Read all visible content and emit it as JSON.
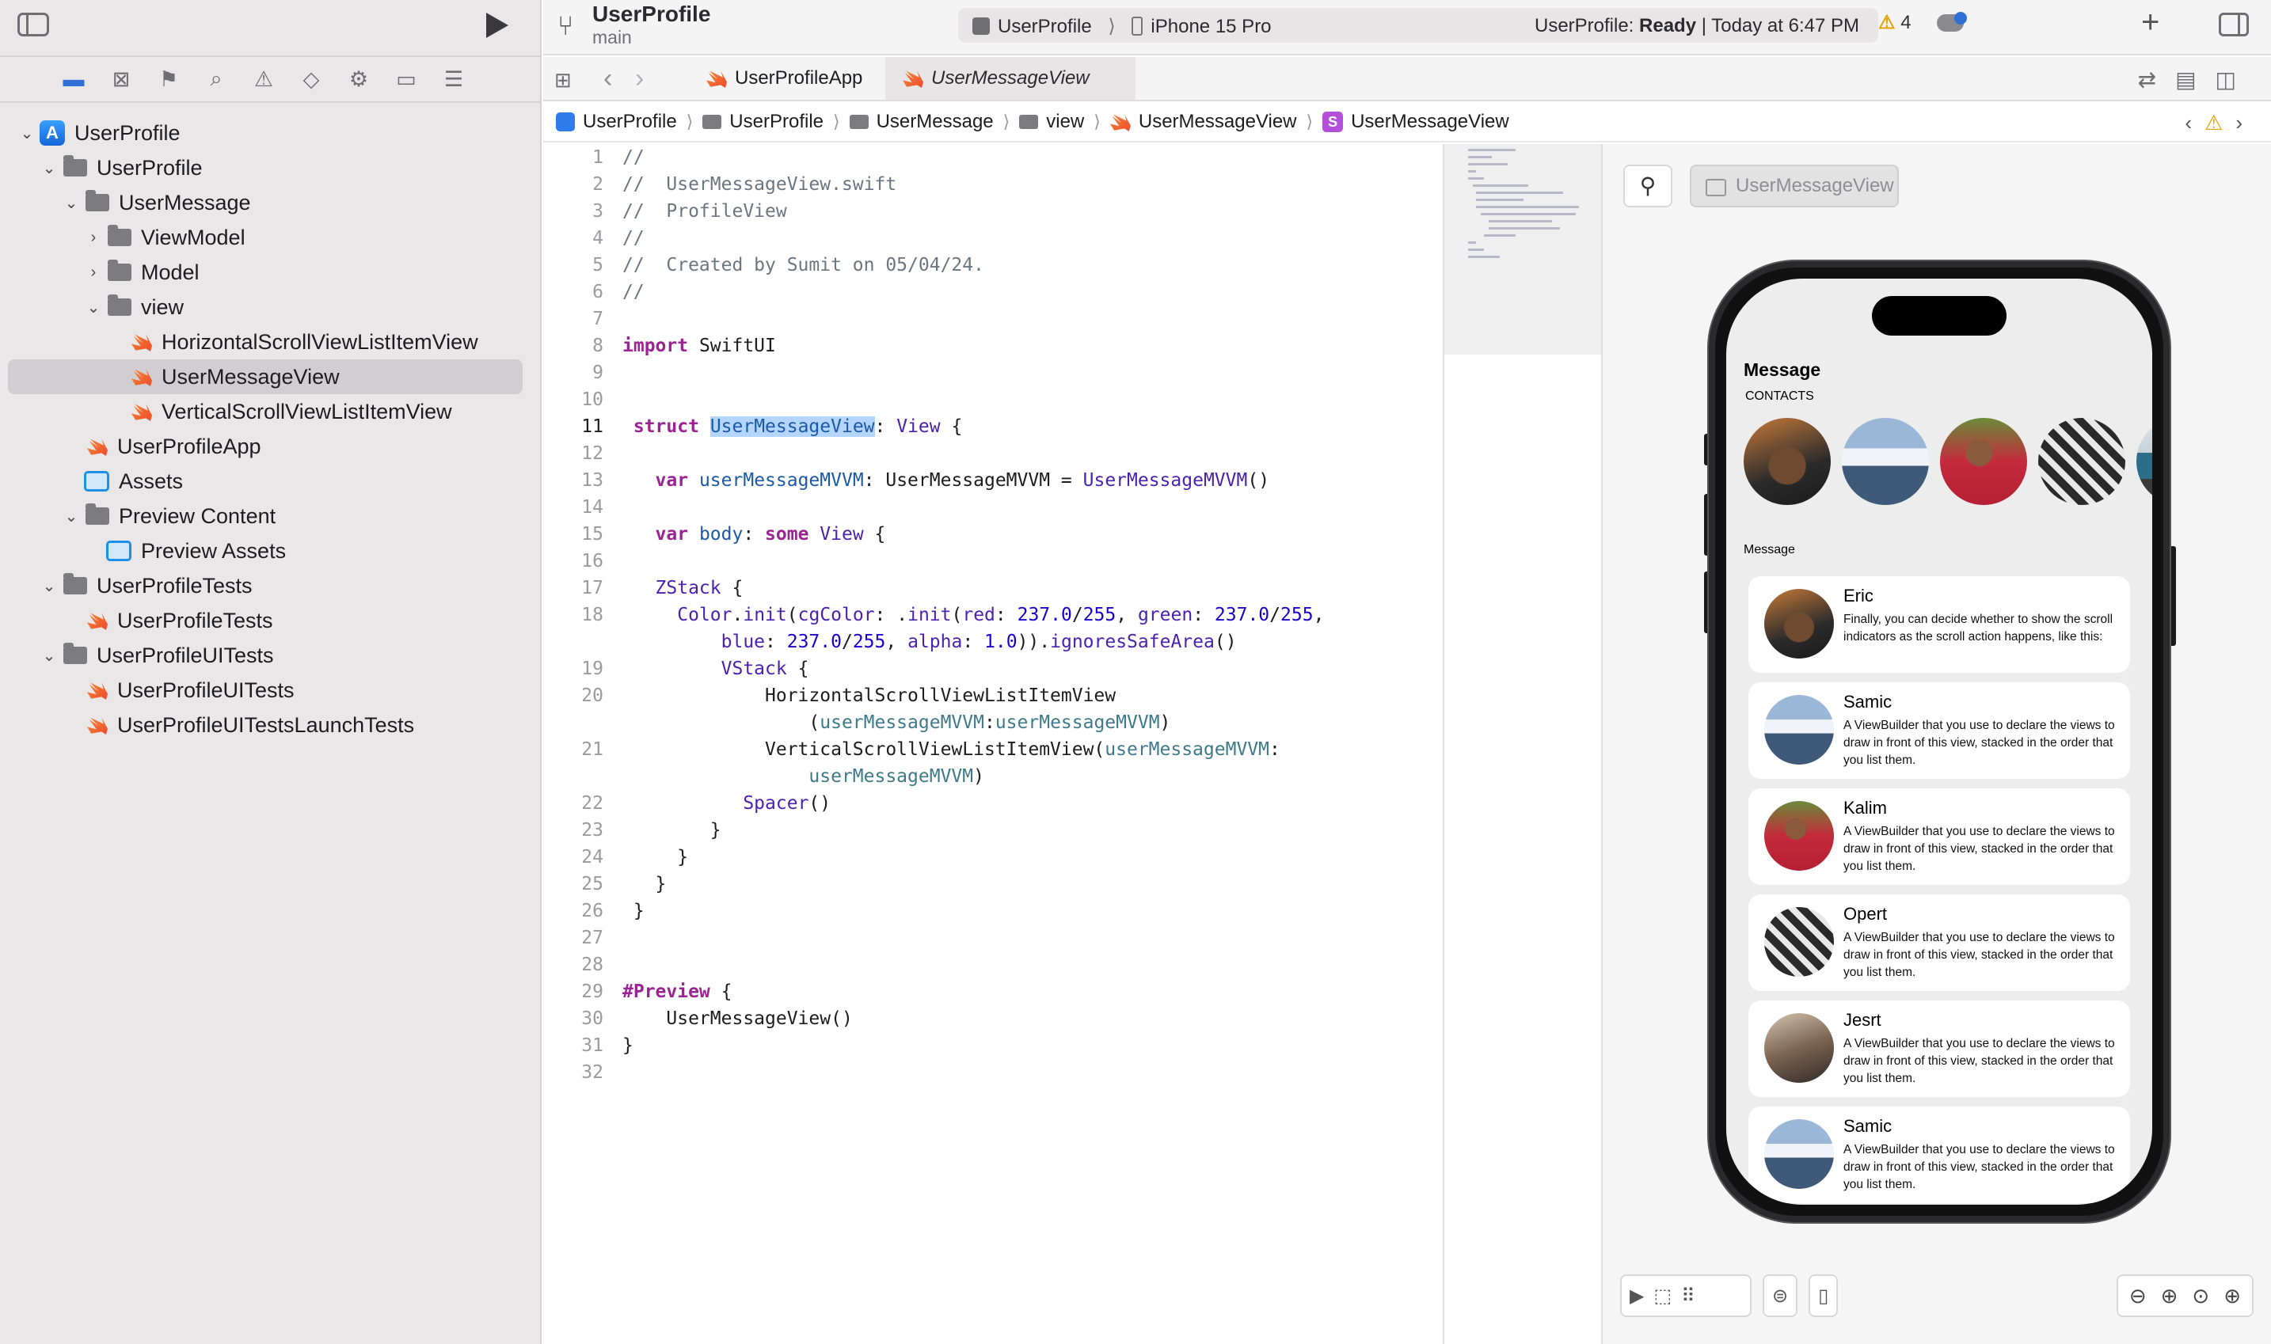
{
  "topbar": {
    "project": "UserProfile",
    "branch": "main",
    "scheme": "UserProfile",
    "destination": "iPhone 15 Pro",
    "status_prefix": "UserProfile: ",
    "status_state": "Ready",
    "status_suffix": " | Today at 6:47 PM",
    "warnings": "4"
  },
  "tabs": [
    {
      "label": "UserProfileApp"
    },
    {
      "label": "UserMessageView"
    }
  ],
  "jumpbar": [
    "UserProfile",
    "UserProfile",
    "UserMessage",
    "view",
    "UserMessageView",
    "UserMessageView"
  ],
  "tree": [
    {
      "label": "UserProfile",
      "indent": 0,
      "chev": "⌄",
      "icon": "proj"
    },
    {
      "label": "UserProfile",
      "indent": 1,
      "chev": "⌄",
      "icon": "folder"
    },
    {
      "label": "UserMessage",
      "indent": 2,
      "chev": "⌄",
      "icon": "folder"
    },
    {
      "label": "ViewModel",
      "indent": 3,
      "chev": "›",
      "icon": "folder"
    },
    {
      "label": "Model",
      "indent": 3,
      "chev": "›",
      "icon": "folder"
    },
    {
      "label": "view",
      "indent": 3,
      "chev": "⌄",
      "icon": "folder"
    },
    {
      "label": "HorizontalScrollViewListItemView",
      "indent": 4,
      "chev": "",
      "icon": "swift"
    },
    {
      "label": "UserMessageView",
      "indent": 4,
      "chev": "",
      "icon": "swift",
      "selected": true
    },
    {
      "label": "VerticalScrollViewListItemView",
      "indent": 4,
      "chev": "",
      "icon": "swift"
    },
    {
      "label": "UserProfileApp",
      "indent": 2,
      "chev": "",
      "icon": "swift"
    },
    {
      "label": "Assets",
      "indent": 2,
      "chev": "",
      "icon": "assets"
    },
    {
      "label": "Preview Content",
      "indent": 2,
      "chev": "⌄",
      "icon": "folder"
    },
    {
      "label": "Preview Assets",
      "indent": 3,
      "chev": "",
      "icon": "assets"
    },
    {
      "label": "UserProfileTests",
      "indent": 1,
      "chev": "⌄",
      "icon": "folder"
    },
    {
      "label": "UserProfileTests",
      "indent": 2,
      "chev": "",
      "icon": "swift"
    },
    {
      "label": "UserProfileUITests",
      "indent": 1,
      "chev": "⌄",
      "icon": "folder"
    },
    {
      "label": "UserProfileUITests",
      "indent": 2,
      "chev": "",
      "icon": "swift"
    },
    {
      "label": "UserProfileUITestsLaunchTests",
      "indent": 2,
      "chev": "",
      "icon": "swift"
    }
  ],
  "code": {
    "current_line": "11",
    "lines": [
      {
        "n": "1",
        "html": "<span class='cm'>//</span>"
      },
      {
        "n": "2",
        "html": "<span class='cm'>//  UserMessageView.swift</span>"
      },
      {
        "n": "3",
        "html": "<span class='cm'>//  ProfileView</span>"
      },
      {
        "n": "4",
        "html": "<span class='cm'>//</span>"
      },
      {
        "n": "5",
        "html": "<span class='cm'>//  Created by Sumit on 05/04/24.</span>"
      },
      {
        "n": "6",
        "html": "<span class='cm'>//</span>"
      },
      {
        "n": "7",
        "html": ""
      },
      {
        "n": "8",
        "html": "<span class='kw'>import</span> SwiftUI"
      },
      {
        "n": "9",
        "html": ""
      },
      {
        "n": "10",
        "html": ""
      },
      {
        "n": "11",
        "html": " <span class='kw'>struct</span> <span class='hl ty'>UserMessageView</span>: <span class='fn'>View</span> {"
      },
      {
        "n": "12",
        "html": ""
      },
      {
        "n": "13",
        "html": "   <span class='kw'>var</span> <span class='ty'>userMessageMVVM</span>: UserMessageMVVM = <span class='fn'>UserMessageMVVM</span>()"
      },
      {
        "n": "14",
        "html": ""
      },
      {
        "n": "15",
        "html": "   <span class='kw'>var</span> <span class='ty'>body</span>: <span class='kw'>some</span> <span class='fn'>View</span> {"
      },
      {
        "n": "16",
        "html": ""
      },
      {
        "n": "17",
        "html": "   <span class='fn'>ZStack</span> {"
      },
      {
        "n": "18",
        "html": "     <span class='fn'>Color</span>.<span class='fn'>init</span>(<span class='fn'>cgColor</span>: .<span class='fn'>init</span>(<span class='fn'>red</span>: <span class='nm'>237.0</span>/<span class='nm'>255</span>, <span class='fn'>green</span>: <span class='nm'>237.0</span>/<span class='nm'>255</span>,"
      },
      {
        "n": "",
        "html": "         <span class='fn'>blue</span>: <span class='nm'>237.0</span>/<span class='nm'>255</span>, <span class='fn'>alpha</span>: <span class='nm'>1.0</span>)).<span class='fn'>ignoresSafeArea</span>()"
      },
      {
        "n": "19",
        "html": "         <span class='fn'>VStack</span> {"
      },
      {
        "n": "20",
        "html": "             HorizontalScrollViewListItemView"
      },
      {
        "n": "",
        "html": "                 (<span class='pr'>userMessageMVVM</span>:<span class='pr'>userMessageMVVM</span>)"
      },
      {
        "n": "21",
        "html": "             VerticalScrollViewListItemView(<span class='pr'>userMessageMVVM</span>:"
      },
      {
        "n": "",
        "html": "                 <span class='pr'>userMessageMVVM</span>)"
      },
      {
        "n": "22",
        "html": "           <span class='fn'>Spacer</span>()"
      },
      {
        "n": "23",
        "html": "        }"
      },
      {
        "n": "24",
        "html": "     }"
      },
      {
        "n": "25",
        "html": "   }"
      },
      {
        "n": "26",
        "html": " }"
      },
      {
        "n": "27",
        "html": ""
      },
      {
        "n": "28",
        "html": ""
      },
      {
        "n": "29",
        "html": "<span class='kw'>#Preview</span> {"
      },
      {
        "n": "30",
        "html": "    UserMessageView()"
      },
      {
        "n": "31",
        "html": "}"
      },
      {
        "n": "32",
        "html": ""
      }
    ]
  },
  "preview": {
    "chip_label": "UserMessageView",
    "title": "Message",
    "contacts_label": "CONTACTS",
    "message_label": "Message",
    "messages": [
      {
        "name": "Eric",
        "text": "Finally, you can decide whether to show the scroll indicators as the scroll action happens, like this:",
        "avatar": "av1"
      },
      {
        "name": "Samic",
        "text": "A ViewBuilder that you use to declare the views to draw in front of this view, stacked in the order that you list them.",
        "avatar": "av2"
      },
      {
        "name": "Kalim",
        "text": "A ViewBuilder that you use to declare the views to draw in front of this view, stacked in the order that you list them.",
        "avatar": "av3"
      },
      {
        "name": "Opert",
        "text": "A ViewBuilder that you use to declare the views to draw in front of this view, stacked in the order that you list them.",
        "avatar": "av4"
      },
      {
        "name": "Jesrt",
        "text": "A ViewBuilder that you use to declare the views to draw in front of this view, stacked in the order that you list them.",
        "avatar": "av6"
      },
      {
        "name": "Samic",
        "text": "A ViewBuilder that you use to declare the views to draw in front of this view, stacked in the order that you list them.",
        "avatar": "av2"
      }
    ],
    "contacts": [
      "av1",
      "av2",
      "av3",
      "av4",
      "av5"
    ]
  }
}
